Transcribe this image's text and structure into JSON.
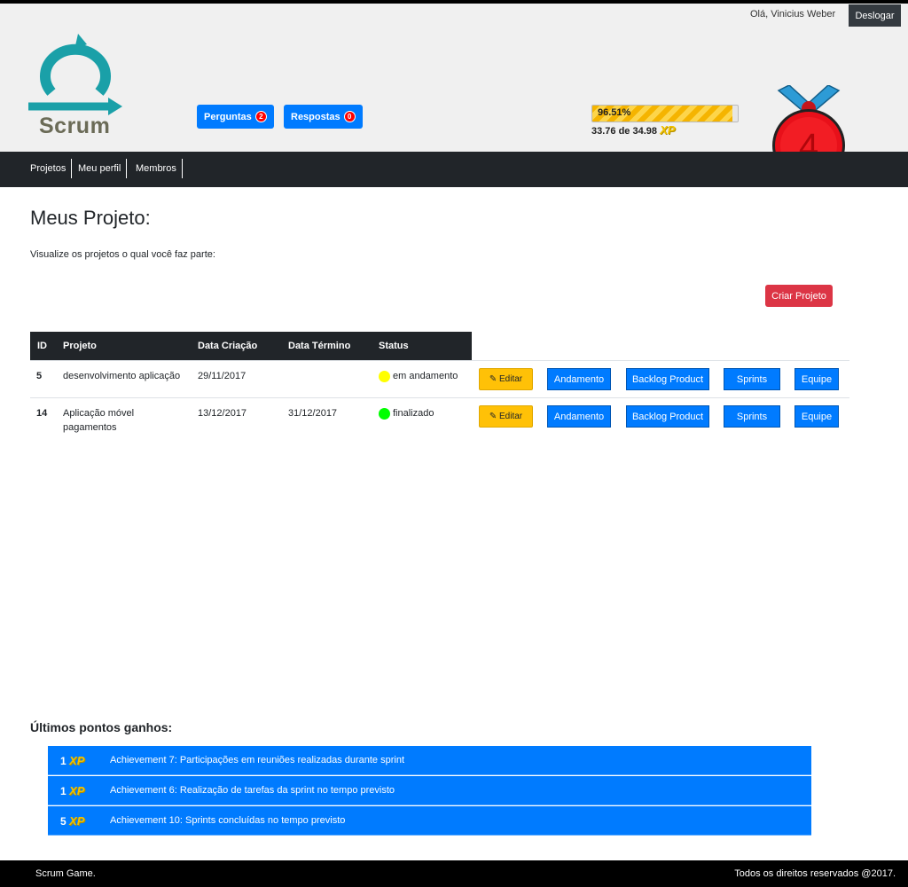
{
  "header": {
    "greeting": "Olá, Vinicius Weber",
    "logout_label": "Deslogar",
    "logo_text": "Scrum",
    "questions_label": "Perguntas",
    "questions_count": "2",
    "answers_label": "Respostas",
    "answers_count": "0",
    "xp_percent_text": "96.51%",
    "xp_progress": 0.9651,
    "xp_amount_text": "33.76 de 34.98",
    "xp_logo": "XP",
    "level": "4"
  },
  "nav": {
    "items": [
      {
        "label": "Projetos"
      },
      {
        "label": "Meu perfil"
      },
      {
        "label": "Membros"
      }
    ]
  },
  "main": {
    "title": "Meus Projeto:",
    "subtitle": "Visualize os projetos o qual você faz parte:",
    "create_label": "Criar Projeto"
  },
  "table": {
    "headers": [
      "ID",
      "Projeto",
      "Data Criação",
      "Data Término",
      "Status"
    ],
    "rows": [
      {
        "id": "5",
        "name": "desenvolvimento aplicação",
        "created": "29/11/2017",
        "ended": "",
        "status": "em andamento",
        "status_color": "#ffff00"
      },
      {
        "id": "14",
        "name": "Aplicação móvel pagamentos",
        "created": "13/12/2017",
        "ended": "31/12/2017",
        "status": "finalizado",
        "status_color": "#00ff00"
      }
    ],
    "actions": {
      "edit": "Editar",
      "progress": "Andamento",
      "backlog": "Backlog Product",
      "sprints": "Sprints",
      "team": "Equipe"
    }
  },
  "points": {
    "title": "Últimos pontos ganhos:",
    "items": [
      {
        "amount": "1",
        "text": "Achievement 7: Participações em reuniões realizadas durante sprint"
      },
      {
        "amount": "1",
        "text": "Achievement 6: Realização de tarefas da sprint no tempo previsto"
      },
      {
        "amount": "5",
        "text": "Achievement 10: Sprints concluídas no tempo previsto"
      }
    ]
  },
  "footer": {
    "left": "Scrum Game.",
    "right": "Todos os direitos reservados @2017."
  },
  "colors": {
    "primary": "#007bff",
    "danger": "#dc3545",
    "warning": "#ffc107",
    "dark": "#212529"
  }
}
